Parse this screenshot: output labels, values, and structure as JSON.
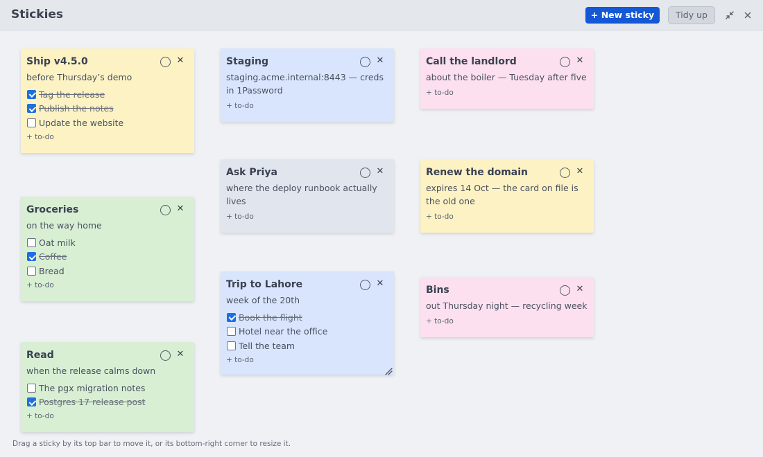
{
  "app": {
    "title": "Stickies"
  },
  "toolbar": {
    "new_sticky": "+ New sticky",
    "tidy_up": "Tidy up"
  },
  "notes": {
    "ship": {
      "title": "Ship v4.5.0",
      "subtitle": "before Thursday’s demo",
      "todos": [
        {
          "label": "Tag the release",
          "done": true
        },
        {
          "label": "Publish the notes",
          "done": true
        },
        {
          "label": "Update the website",
          "done": false
        }
      ],
      "add_todo": "+ to-do",
      "color": "#fcf2c4"
    },
    "groceries": {
      "title": "Groceries",
      "subtitle": "on the way home",
      "todos": [
        {
          "label": "Oat milk",
          "done": false
        },
        {
          "label": "Coffee",
          "done": true
        },
        {
          "label": "Bread",
          "done": false
        }
      ],
      "add_todo": "+ to-do",
      "color": "#d8efd4"
    },
    "read": {
      "title": "Read",
      "subtitle": "when the release calms down",
      "todos": [
        {
          "label": "The pgx migration notes",
          "done": false
        },
        {
          "label": "Postgres 17 release post",
          "done": true
        }
      ],
      "add_todo": "+ to-do",
      "color": "#d8efd4"
    },
    "staging": {
      "title": "Staging",
      "subtitle": "staging.acme.internal:8443 — creds in 1Password",
      "add_todo": "+ to-do",
      "color": "#d8e5fd"
    },
    "ask_priya": {
      "title": "Ask Priya",
      "subtitle": "where the deploy runbook actually lives",
      "add_todo": "+ to-do",
      "color": "#e1e5ed"
    },
    "trip": {
      "title": "Trip to Lahore",
      "subtitle": "week of the 20th",
      "todos": [
        {
          "label": "Book the flight",
          "done": true
        },
        {
          "label": "Hotel near the office",
          "done": false
        },
        {
          "label": "Tell the team",
          "done": false
        }
      ],
      "add_todo": "+ to-do",
      "color": "#d8e5fd"
    },
    "landlord": {
      "title": "Call the landlord",
      "subtitle": "about the boiler — Tuesday after five",
      "add_todo": "+ to-do",
      "color": "#fce0ef"
    },
    "domain": {
      "title": "Renew the domain",
      "subtitle": "expires 14 Oct — the card on file is the old one",
      "add_todo": "+ to-do",
      "color": "#fcf2c4"
    },
    "bins": {
      "title": "Bins",
      "subtitle": "out Thursday night — recycling week",
      "add_todo": "+ to-do",
      "color": "#fce0ef"
    }
  },
  "footer": {
    "hint": "Drag a sticky by its top bar to move it, or its bottom-right corner to resize it."
  },
  "icons": {
    "collapse": "collapse-icon",
    "close": "close-icon",
    "complete": "circle-icon",
    "resize": "resize-grip-icon"
  },
  "colors": {
    "accent": "#1558d6",
    "checkbox": "#1e6fe0"
  }
}
